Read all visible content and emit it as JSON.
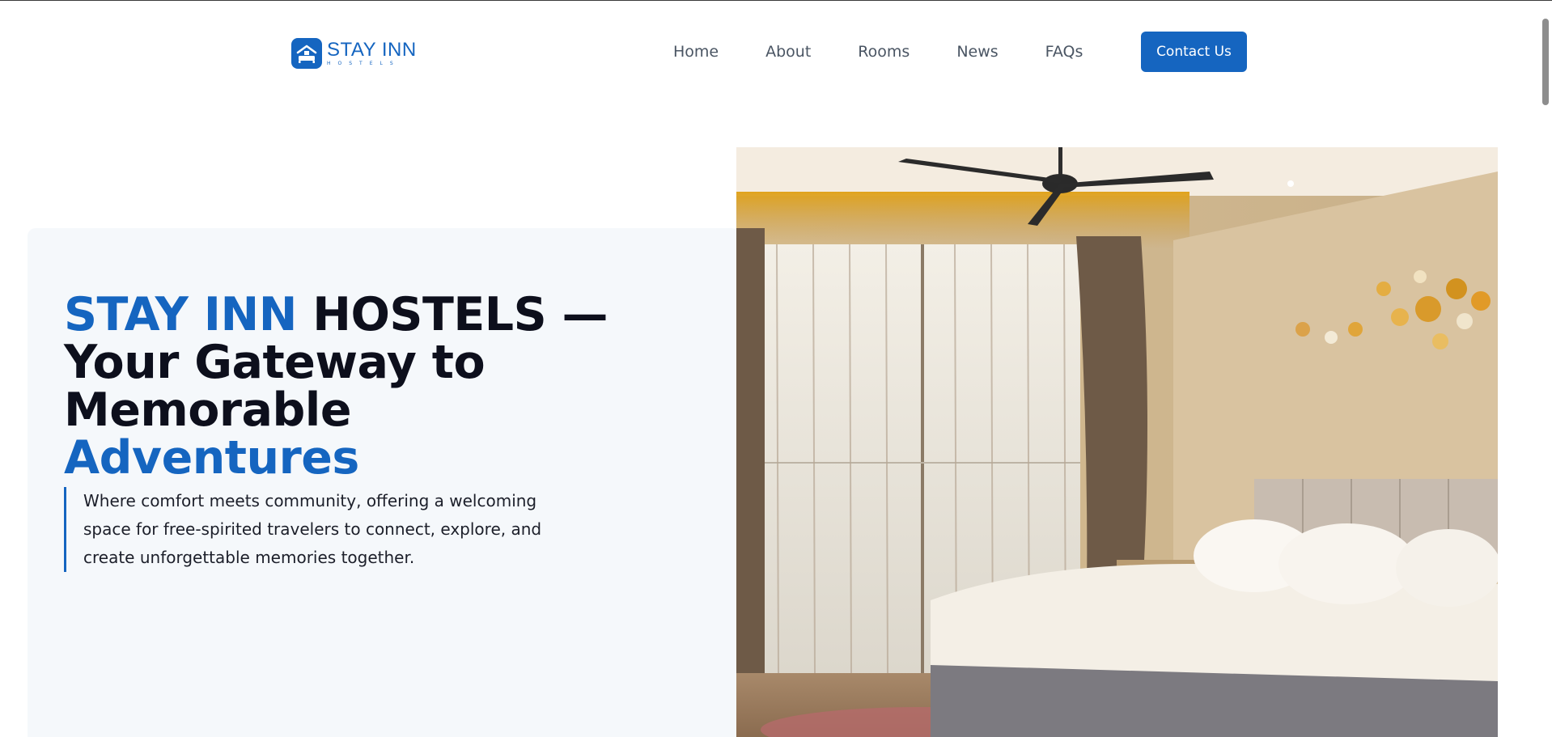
{
  "brand": {
    "name": "STAY INN",
    "sub": "HOSTELS"
  },
  "nav": {
    "items": [
      {
        "label": "Home"
      },
      {
        "label": "About"
      },
      {
        "label": "Rooms"
      },
      {
        "label": "News"
      },
      {
        "label": "FAQs"
      }
    ],
    "contact_label": "Contact Us"
  },
  "hero": {
    "title_part1": "STAY INN",
    "title_part2": " HOSTELS —",
    "title_part3": "Your Gateway to",
    "title_part4": "Memorable ",
    "title_part5": "Adventures",
    "description": "Where comfort meets community, offering a welcoming space for free-spirited travelers to connect, explore, and create unforgettable memories together."
  },
  "colors": {
    "brand_blue": "#1565c0",
    "heading_dark": "#0d0f1c",
    "panel_bg": "#f5f8fb",
    "nav_text": "#4a5563"
  },
  "icons": {
    "logo": "hotel-bed-icon"
  }
}
